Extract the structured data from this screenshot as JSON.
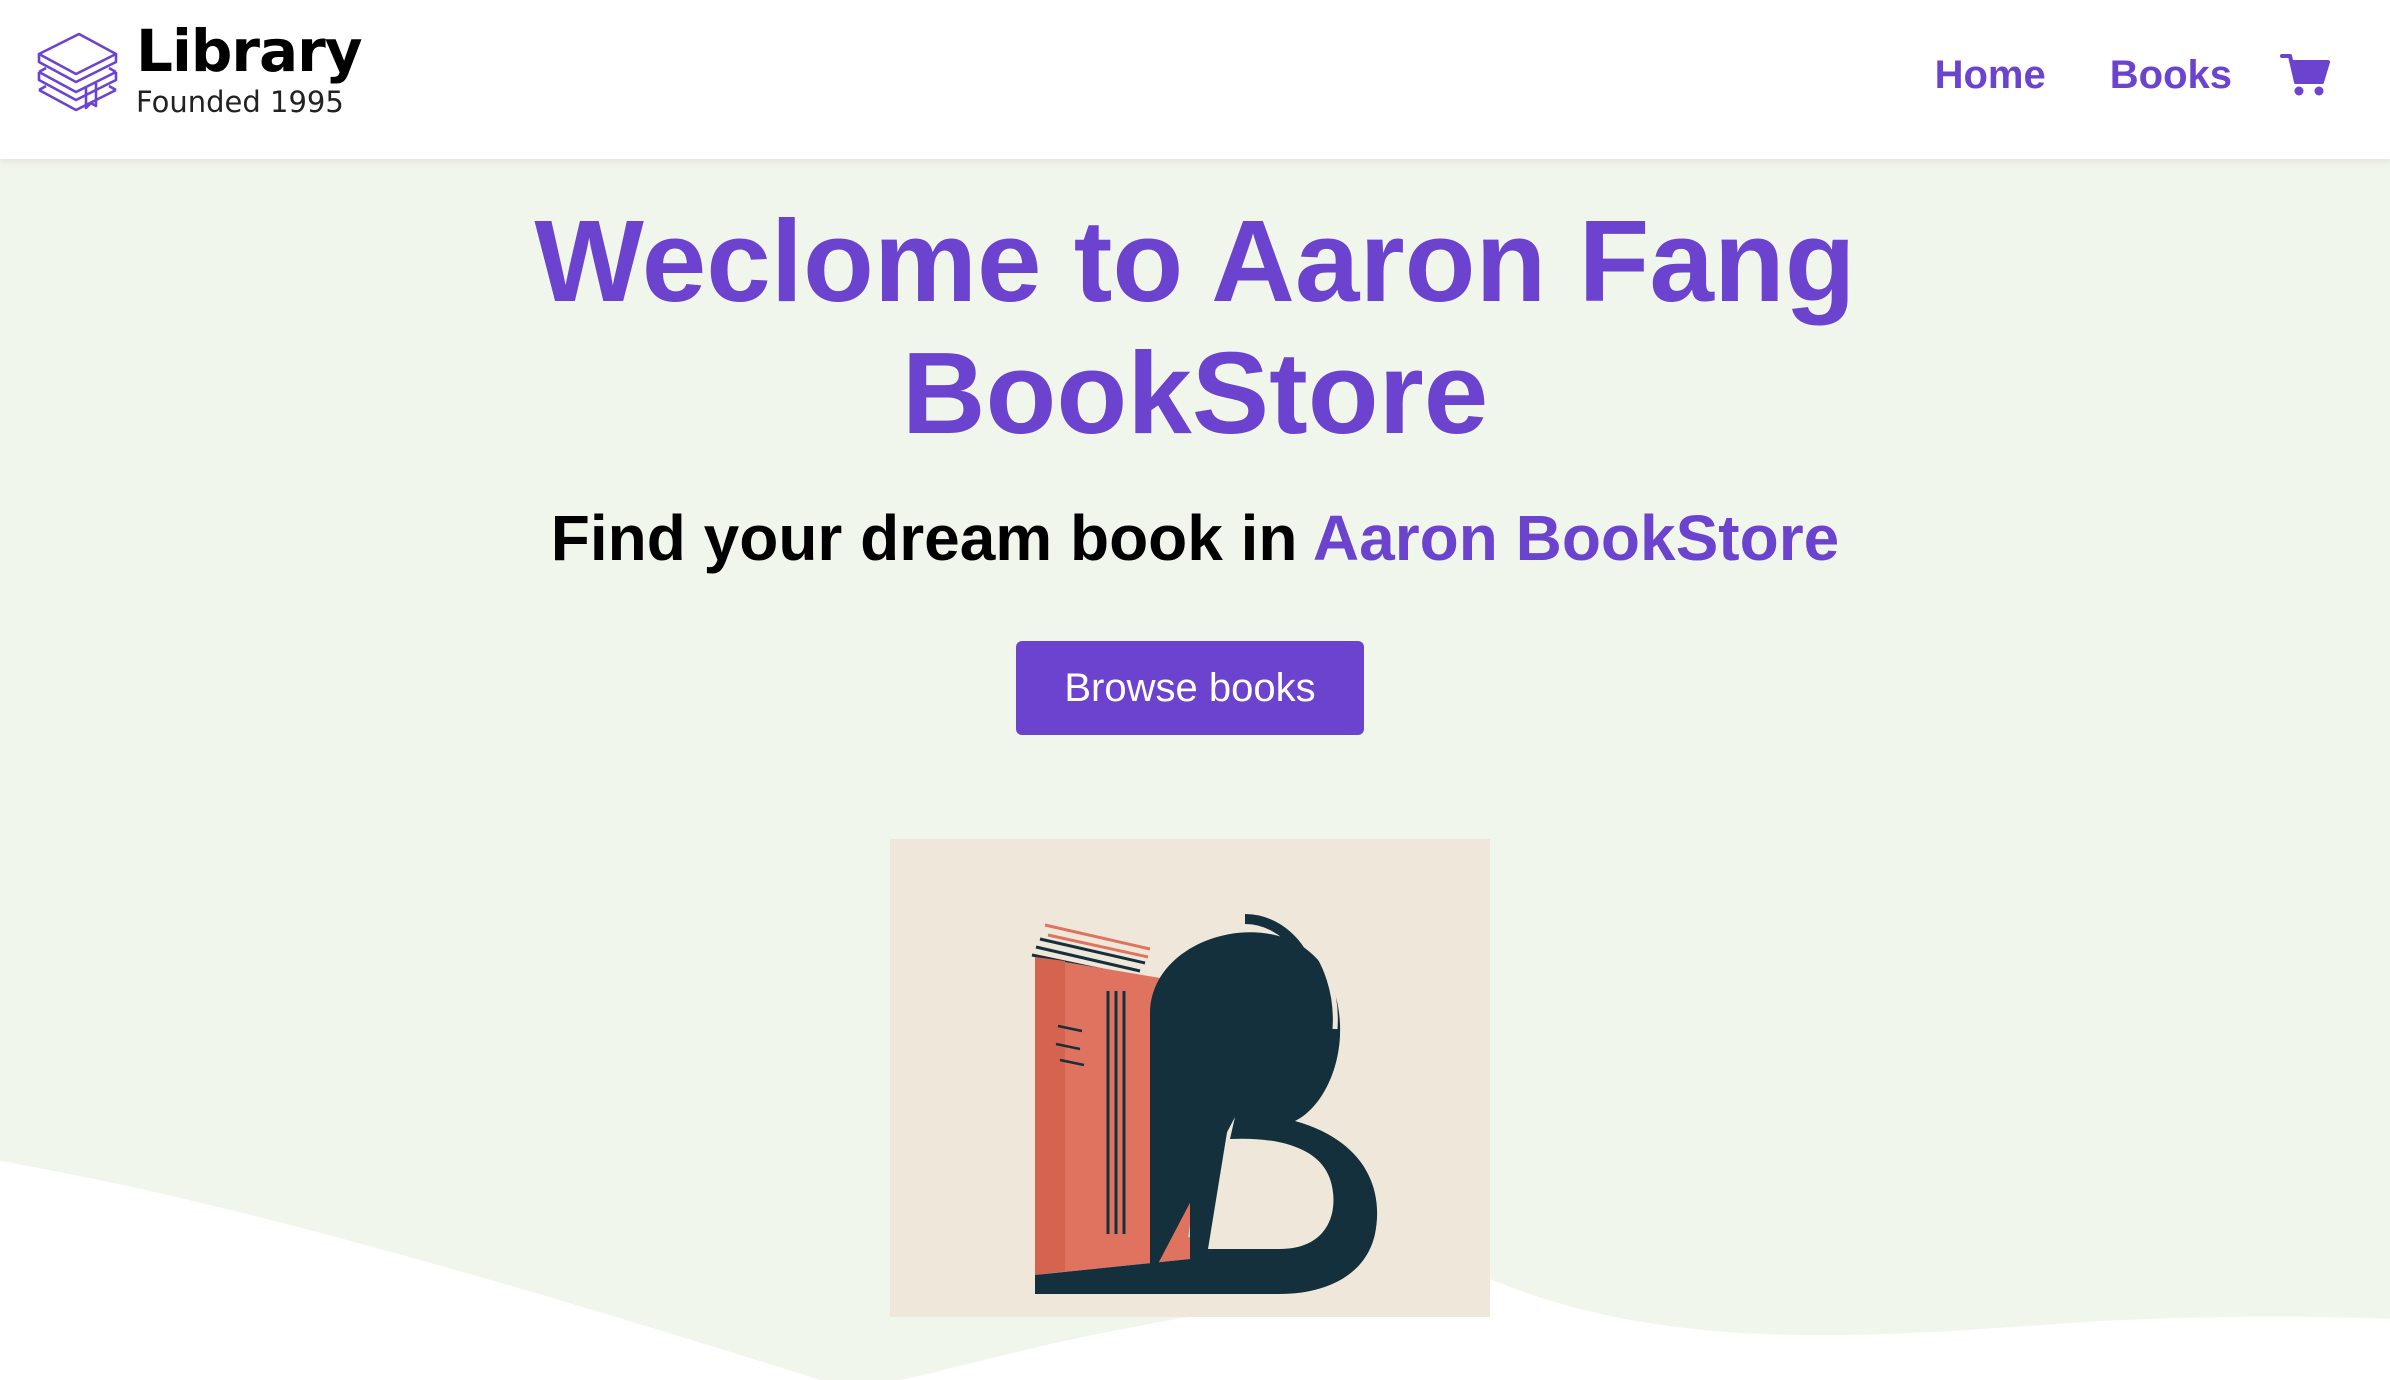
{
  "header": {
    "brand_name": "Library",
    "brand_tagline": "Founded 1995",
    "brand_icon": "stacked-books-icon",
    "nav": [
      {
        "label": "Home"
      },
      {
        "label": "Books"
      }
    ],
    "cart_icon": "shopping-cart-icon"
  },
  "hero": {
    "title_line1": "Weclome to Aaron Fang",
    "title_line2": "BookStore",
    "subtitle_prefix": "Find your dream book in ",
    "subtitle_accent": "Aaron BookStore",
    "button_label": "Browse books",
    "image_alt": "stylized letter B book logo"
  },
  "colors": {
    "accent": "#6c43cf",
    "hero_background": "#f1f6ec",
    "image_background": "#efe7da",
    "logo_red": "#e0735f",
    "logo_navy": "#14303d",
    "logo_cyan": "#9fd6d6"
  }
}
